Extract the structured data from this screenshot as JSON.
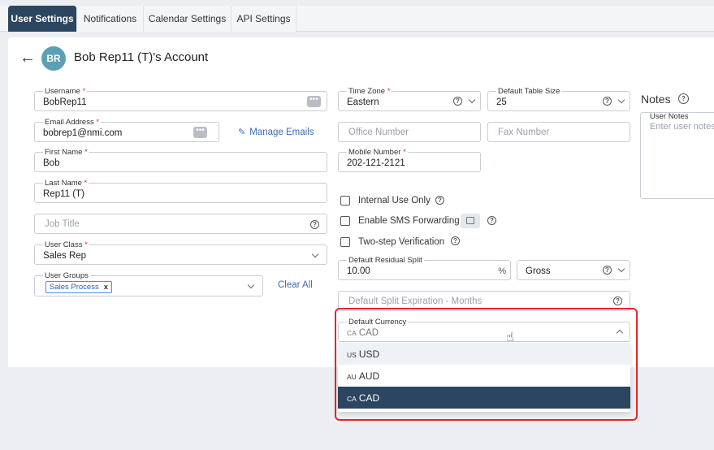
{
  "tabs": [
    {
      "label": "User Settings",
      "active": true
    },
    {
      "label": "Notifications",
      "active": false
    },
    {
      "label": "Calendar Settings",
      "active": false
    },
    {
      "label": "API Settings",
      "active": false
    }
  ],
  "header": {
    "avatar_initials": "BR",
    "title": "Bob Rep11 (T)'s Account"
  },
  "form": {
    "username": {
      "label": "Username",
      "value": "BobRep11"
    },
    "email": {
      "label": "Email Address",
      "value": "bobrep1@nmi.com"
    },
    "manage_emails": "Manage Emails",
    "first_name": {
      "label": "First Name",
      "value": "Bob"
    },
    "last_name": {
      "label": "Last Name",
      "value": "Rep11 (T)"
    },
    "job_title": {
      "placeholder": "Job Title"
    },
    "user_class": {
      "label": "User Class",
      "value": "Sales Rep"
    },
    "user_groups": {
      "label": "User Groups",
      "chip": "Sales Process"
    },
    "clear_all": "Clear All",
    "time_zone": {
      "label": "Time Zone",
      "value": "Eastern"
    },
    "default_table_size": {
      "label": "Default Table Size",
      "value": "25"
    },
    "office_number": {
      "placeholder": "Office Number"
    },
    "fax_number": {
      "placeholder": "Fax Number"
    },
    "mobile_number": {
      "label": "Mobile Number",
      "value": "202-121-2121"
    },
    "internal_use_only": "Internal Use Only",
    "enable_sms": "Enable SMS Forwarding",
    "two_step": "Two-step Verification",
    "residual_split": {
      "label": "Default Residual Split",
      "value": "10.00",
      "unit": "%"
    },
    "gross": {
      "value": "Gross"
    },
    "split_expiration": {
      "placeholder": "Default Split Expiration - Months"
    },
    "default_currency": {
      "label": "Default Currency",
      "code": "CA",
      "value": "CAD"
    },
    "currency_options": [
      {
        "code": "US",
        "label": "USD",
        "selected": false
      },
      {
        "code": "AU",
        "label": "AUD",
        "selected": false
      },
      {
        "code": "CA",
        "label": "CAD",
        "selected": true
      }
    ]
  },
  "notes": {
    "heading": "Notes",
    "label": "User Notes",
    "placeholder": "Enter user notes"
  },
  "icons": {
    "help": "?",
    "more": "•••",
    "back": "←",
    "remove": "x"
  },
  "colors": {
    "accent": "#2c4560",
    "link": "#3b6db3",
    "required": "#d9363e",
    "highlight": "#e3262b"
  }
}
